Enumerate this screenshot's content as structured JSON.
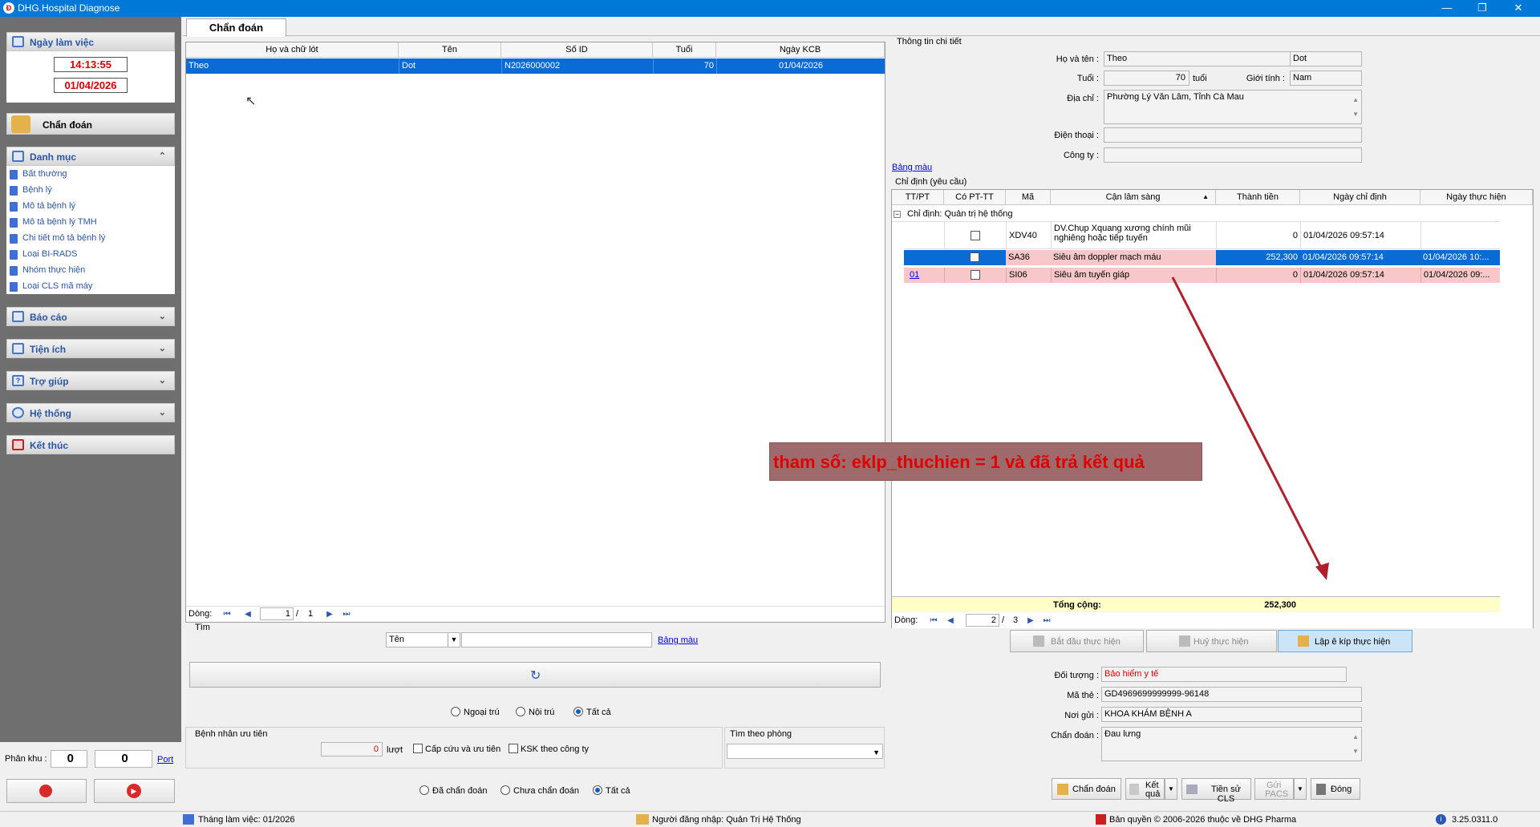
{
  "window": {
    "title": "DHG.Hospital Diagnose",
    "app_icon": "Đ"
  },
  "sidebar": {
    "work_day_label": "Ngày làm việc",
    "time": "14:13:55",
    "date": "01/04/2026",
    "active_label": "Chẩn đoán",
    "danh_muc": "Danh mục",
    "danh_muc_items": [
      "Bất thường",
      "Bệnh lý",
      "Mô tả bệnh lý",
      "Mô tả bệnh lý TMH",
      "Chi tiết mô tả bệnh lý",
      "Loại BI-RADS",
      "Nhóm thực hiện",
      "Loại CLS mã máy"
    ],
    "groups": [
      "Báo cáo",
      "Tiện ích",
      "Trợ giúp",
      "Hệ thống",
      "Kết thúc"
    ],
    "phan_khu_label": "Phân khu :",
    "phan_khu_value": "0",
    "port_value": "0",
    "port_label": "Port"
  },
  "tab": {
    "label": "Chẩn đoán"
  },
  "patient_grid": {
    "columns": [
      "Họ và chữ lót",
      "Tên",
      "Số ID",
      "Tuổi",
      "Ngày KCB"
    ],
    "rows": [
      [
        "Theo",
        "Dot",
        "N2026000002",
        "70",
        "01/04/2026"
      ]
    ],
    "nav_label": "Dòng:",
    "page": "1",
    "of": "1"
  },
  "search": {
    "group_label": "Tìm",
    "field": "Tên",
    "link": "Bảng màu",
    "radios": [
      "Ngoại trú",
      "Nội trú",
      "Tất cả"
    ],
    "radio_selected": 2
  },
  "priority": {
    "label": "Bệnh nhân ưu tiên",
    "count": "0",
    "unit": "lượt",
    "chk1": "Cấp cứu và ưu tiên",
    "chk2": "KSK theo công ty",
    "room_label": "Tìm theo phòng"
  },
  "diag_filter": {
    "radios": [
      "Đã chẩn đoán",
      "Chưa chẩn đoán",
      "Tất cả"
    ],
    "radio_selected": 2
  },
  "detail": {
    "group_label": "Thông tin chi tiết",
    "name_label": "Họ và tên :",
    "first": "Theo",
    "last": "Dot",
    "age_label": "Tuổi :",
    "age": "70",
    "age_unit": "tuổi",
    "gender_label": "Giới tính :",
    "gender": "Nam",
    "address_label": "Địa chỉ :",
    "address": "Phường Lý Văn Lâm, Tỉnh Cà Mau",
    "phone_label": "Điện thoại :",
    "company_label": "Công ty :",
    "color_link": "Bảng màu"
  },
  "orders": {
    "group_label": "Chỉ định (yêu cầu)",
    "columns": [
      "TT/PT",
      "Có PT-TT",
      "Mã",
      "Cận lâm sàng",
      "Thành tiền",
      "Ngày chỉ định",
      "Ngày thực hiện"
    ],
    "group_row": "Chỉ định:  Quản trị hệ thống",
    "rows": [
      {
        "tt": "",
        "code": "XDV40",
        "name": "DV.Chụp Xquang xương chính mũi nghiêng hoặc tiếp tuyến",
        "amount": "0",
        "ordered": "01/04/2026 09:57:14",
        "done": ""
      },
      {
        "tt": "",
        "code": "SA36",
        "name": "Siêu âm doppler mạch máu",
        "amount": "252,300",
        "ordered": "01/04/2026 09:57:14",
        "done": "01/04/2026 10:..."
      },
      {
        "tt": "01",
        "code": "SI06",
        "name": "Siêu âm tuyến giáp",
        "amount": "0",
        "ordered": "01/04/2026 09:57:14",
        "done": "01/04/2026 09:..."
      }
    ],
    "total_label": "Tổng cộng:",
    "total": "252,300",
    "nav_label": "Dòng:",
    "page": "2",
    "of": "3"
  },
  "annotation": "tham số: eklp_thuchien = 1 và đã trả kết quả",
  "actions": {
    "start": "Bắt đầu thực hiện",
    "cancel": "Huỷ thực hiện",
    "ekip": "Lập ê kíp thực hiện"
  },
  "insurance": {
    "obj_label": "Đối tượng :",
    "obj": "Bảo hiểm y tế",
    "card_label": "Mã thẻ :",
    "card": "GD4969699999999-96148",
    "sender_label": "Nơi gửi :",
    "sender": "KHOA KHÁM BỆNH A",
    "diag_label": "Chẩn đoán :",
    "diag": "Đau lưng"
  },
  "bottom_buttons": {
    "diagnose": "Chẩn đoán",
    "result1": "Kết",
    "result2": "quả",
    "history": "Tiền sử CLS",
    "pacs1": "Gửi",
    "pacs2": "PACS",
    "close": "Đóng"
  },
  "status": {
    "month": "Tháng làm việc: 01/2026",
    "user": "Người đăng nhập: Quản Trị Hệ Thống",
    "copyright": "Bản quyền © 2006-2026 thuộc về DHG Pharma",
    "version": "3.25.0311.0"
  },
  "colors": {
    "accent": "#0078d7",
    "selected": "#0a6ad6",
    "highlight": "#f7c7c9",
    "annotation_bg": "#9e6a6c",
    "annotation_text": "#e00000",
    "arrow": "#b0202c"
  }
}
